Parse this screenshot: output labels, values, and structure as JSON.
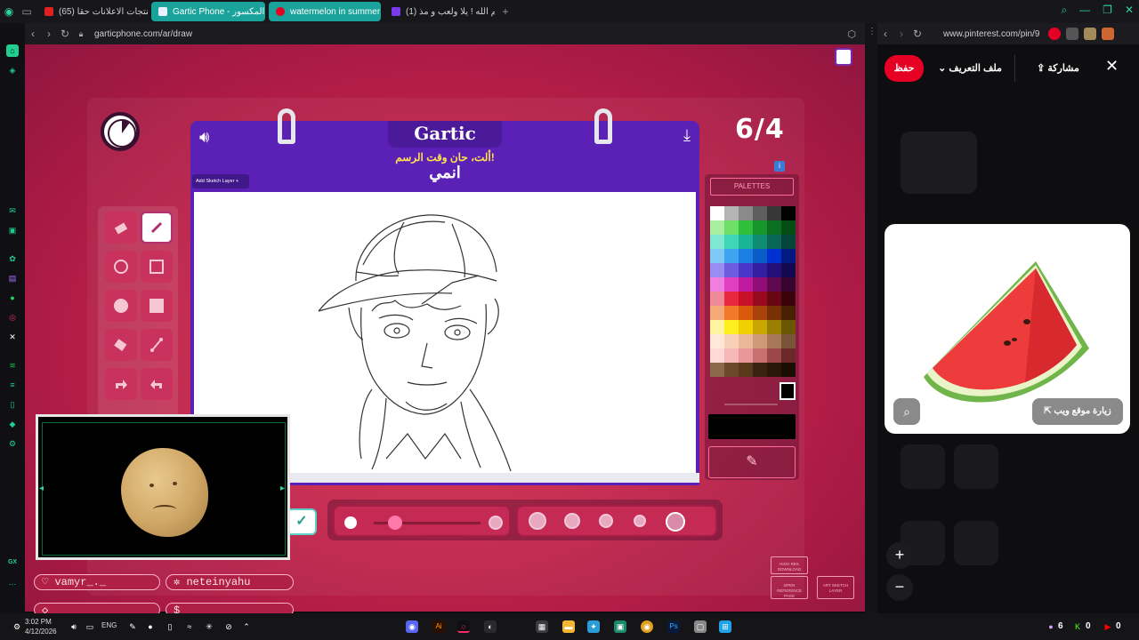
{
  "browser": {
    "tabs": [
      {
        "label": "(65) هل منتجات الاعلانات حقا",
        "fav": "#e02020"
      },
      {
        "label": "Gartic Phone - الهاتف المكسور",
        "fav": "#e8f0ff"
      },
      {
        "label": "watermelon in summer",
        "fav": "#e60023"
      },
      {
        "label": "(1) حياكم الله ! يلا ولعب و مذ",
        "fav": "#7c3aed"
      }
    ],
    "url_left": "garticphone.com/ar/draw",
    "url_right": "www.pinterest.com/pin/9"
  },
  "game": {
    "round": "6/4",
    "logo": "Gartic",
    "prompt_title": "ألت، حان وقت الرسم!",
    "prompt_word": "انمي",
    "add_layer": "Add Sketch Layer  +",
    "palettes_label": "PALETTES",
    "info": "i",
    "btn_high_res": "HIGH RES DOWNLOAD",
    "btn_open_ref": "OPEN REFERENCE PAGE",
    "btn_art_layer": "ART SKETCH LAYER",
    "palette_colors": [
      "#ffffff",
      "#b5b5b5",
      "#8a8a8a",
      "#5e5e5e",
      "#373737",
      "#000000",
      "#a8f0a0",
      "#6ee06a",
      "#2fbf3a",
      "#17962a",
      "#0c6e20",
      "#064d14",
      "#7fe8d0",
      "#3fd6b5",
      "#1ab596",
      "#0e8c74",
      "#0a6656",
      "#05443a",
      "#7ec8f5",
      "#3fa3f0",
      "#1a7fe0",
      "#0a5cc8",
      "#0030d0",
      "#001a80",
      "#9a8cf0",
      "#6e5ce0",
      "#4b36c8",
      "#331fa0",
      "#220f78",
      "#140850",
      "#f07ee0",
      "#e040c0",
      "#c01a9e",
      "#900e76",
      "#600850",
      "#3a0430",
      "#f08a9a",
      "#e8283c",
      "#c8102a",
      "#98081e",
      "#680614",
      "#3a020a",
      "#f5a878",
      "#f07a2a",
      "#d85a0a",
      "#a84208",
      "#783004",
      "#482002",
      "#fff4a0",
      "#ffee20",
      "#f0d000",
      "#c8a800",
      "#9a8000",
      "#6a5800",
      "#ffe8d8",
      "#f8d0b8",
      "#e8b898",
      "#d09a78",
      "#a87858",
      "#7a5438",
      "#ffd8d8",
      "#f8b8b8",
      "#e89898",
      "#c87070",
      "#9a4848",
      "#6a2828",
      "#8a6a4a",
      "#6a4a2a",
      "#5a3a1a",
      "#3a2410",
      "#2a1808",
      "#1a0e04"
    ]
  },
  "players": {
    "p1": "vamyr_._",
    "p2": "neteinyahu"
  },
  "pinterest": {
    "save": "حفظ",
    "profile": "ملف التعريف",
    "share": "مشاركة",
    "visit": "زيارة موقع ويب"
  },
  "taskbar": {
    "time": "3:02 PM",
    "date": "4/12/2026",
    "lang": "ENG",
    "badge1": "6",
    "badge2": "0",
    "badge3": "0"
  }
}
